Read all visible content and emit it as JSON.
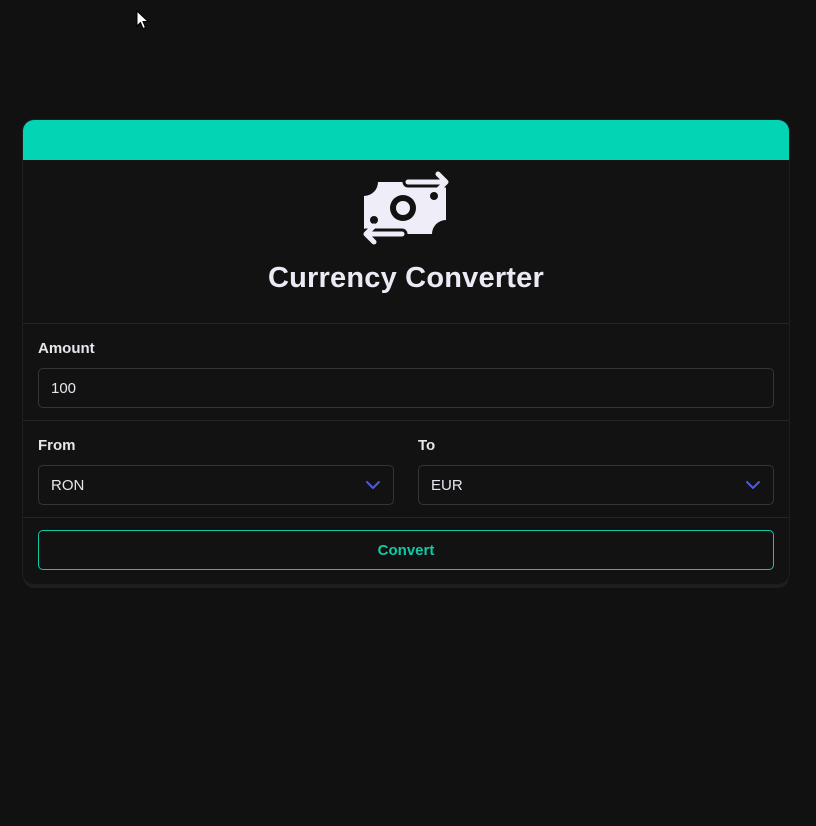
{
  "title": "Currency Converter",
  "icons": {
    "hero": "money-exchange-icon",
    "cursor": "mouse-pointer-icon",
    "dropdown": "chevron-down-icon"
  },
  "colors": {
    "accent": "#02d4b4",
    "button": "#12c9a6",
    "chevron": "#4b5be0",
    "background": "#111112"
  },
  "amount": {
    "label": "Amount",
    "value": "100"
  },
  "from": {
    "label": "From",
    "value": "RON"
  },
  "to": {
    "label": "To",
    "value": "EUR"
  },
  "convert_label": "Convert"
}
